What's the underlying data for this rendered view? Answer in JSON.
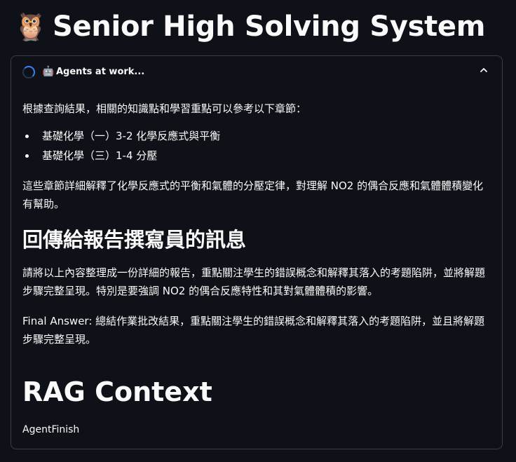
{
  "page": {
    "title_icon": "owl-emoji",
    "title": "Senior High Solving System"
  },
  "expander": {
    "status_icon": "spinner-icon",
    "robot_icon": "robot-emoji",
    "label": "Agents at work...",
    "chevron_icon": "chevron-up-icon",
    "expanded": true
  },
  "content": {
    "intro": "根據查詢結果，相關的知識點和學習重點可以參考以下章節：",
    "chapters": [
      "基礎化學（一）3-2 化學反應式與平衡",
      "基礎化學（三）1-4 分壓"
    ],
    "explanation": "這些章節詳細解釋了化學反應式的平衡和氣體的分壓定律，對理解 NO2 的偶合反應和氣體體積變化有幫助。",
    "section_heading": "回傳給報告撰寫員的訊息",
    "message": "請將以上內容整理成一份詳細的報告，重點關注學生的錯誤概念和解釋其落入的考題陷阱，並將解題步驟完整呈現。特別是要強調 NO2 的偶合反應特性和其對氣體體積的影響。",
    "final_answer": "Final Answer: 總結作業批改結果，重點關注學生的錯誤概念和解釋其落入的考題陷阱，並且將解題步驟完整呈現。",
    "rag_heading": "RAG Context",
    "rag_value": "AgentFinish"
  },
  "colors": {
    "background": "#0e1117",
    "text": "#fafafa",
    "border": "#3a3d48",
    "spinner": "#3b82f6"
  }
}
